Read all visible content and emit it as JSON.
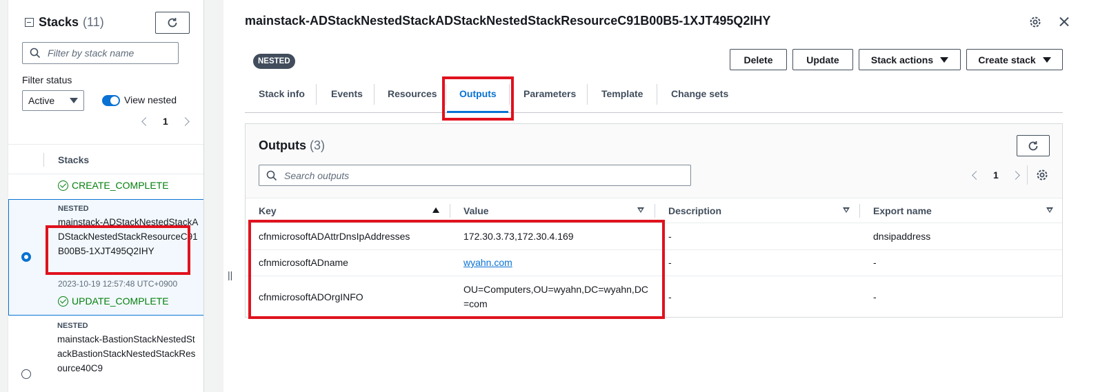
{
  "stacks_panel": {
    "title": "Stacks",
    "count": "(11)",
    "filter_placeholder": "Filter by stack name",
    "filter_status_label": "Filter status",
    "filter_status_value": "Active",
    "view_nested_label": "View nested",
    "view_nested_on": true,
    "page": "1",
    "column_header": "Stacks",
    "rows": [
      {
        "status": "CREATE_COMPLETE"
      },
      {
        "tag": "NESTED",
        "name": "mainstack-ADStackNestedStackADStackNestedStackResourceC91B00B5-1XJT495Q2IHY",
        "time": "2023-10-19 12:57:48 UTC+0900",
        "status": "UPDATE_COMPLETE",
        "selected": true
      },
      {
        "tag": "NESTED",
        "name": "mainstack-BastionStackNestedStackBastionStackNestedStackResource40C9",
        "selected": false
      }
    ]
  },
  "main": {
    "title": "mainstack-ADStackNestedStackADStackNestedStackResourceC91B00B5-1XJT495Q2IHY",
    "badge": "NESTED",
    "buttons": {
      "delete": "Delete",
      "update": "Update",
      "stack_actions": "Stack actions",
      "create_stack": "Create stack"
    },
    "tabs": [
      "Stack info",
      "Events",
      "Resources",
      "Outputs",
      "Parameters",
      "Template",
      "Change sets"
    ],
    "active_tab": "Outputs",
    "resize_handle": "||"
  },
  "outputs": {
    "title": "Outputs",
    "count": "(3)",
    "search_placeholder": "Search outputs",
    "page": "1",
    "columns": [
      "Key",
      "Value",
      "Description",
      "Export name"
    ],
    "rows": [
      {
        "key": "cfnmicrosoftADAttrDnsIpAddresses",
        "value": "172.30.3.73,172.30.4.169",
        "description": "-",
        "export_name": "dnsipaddress"
      },
      {
        "key": "cfnmicrosoftADname",
        "value": "wyahn.com",
        "description": "-",
        "export_name": "-"
      },
      {
        "key": "cfnmicrosoftADOrgINFO",
        "value": "OU=Computers,OU=wyahn,DC=wyahn,DC=com",
        "description": "-",
        "export_name": "-"
      }
    ]
  },
  "colors": {
    "accent": "#0972d3",
    "success": "#037f0c",
    "highlight_box": "#e0121e",
    "badge_bg": "#414d5c"
  }
}
